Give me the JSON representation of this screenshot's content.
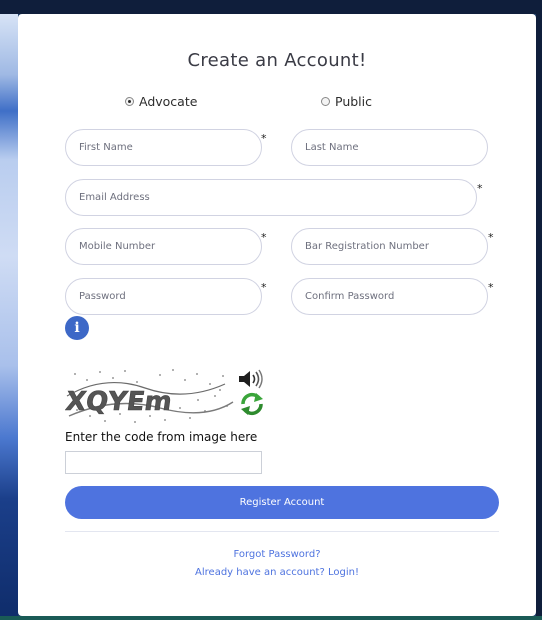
{
  "title": "Create an Account!",
  "user_type": {
    "options": [
      {
        "label": "Advocate",
        "selected": true
      },
      {
        "label": "Public",
        "selected": false
      }
    ]
  },
  "fields": {
    "first_name": {
      "placeholder": "First Name",
      "required": true
    },
    "last_name": {
      "placeholder": "Last Name",
      "required": false
    },
    "email": {
      "placeholder": "Email Address",
      "required": true
    },
    "mobile": {
      "placeholder": "Mobile Number",
      "required": true
    },
    "bar_registration": {
      "placeholder": "Bar Registration Number",
      "required": true
    },
    "password": {
      "placeholder": "Password",
      "required": true
    },
    "confirm_password": {
      "placeholder": "Confirm Password",
      "required": true
    }
  },
  "required_marker": "*",
  "info_glyph": "i",
  "captcha": {
    "text": "XQYEm",
    "instruction": "Enter the code from image here",
    "input_value": ""
  },
  "register_button": "Register Account",
  "links": {
    "forgot_password": "Forgot Password?",
    "login": "Already have an account? Login!"
  },
  "colors": {
    "primary": "#4e73df",
    "info_icon": "#3d68c7",
    "refresh_icon": "#3aa53a",
    "card_bg": "#ffffff"
  },
  "icons": [
    "info-icon",
    "speaker-icon",
    "refresh-icon"
  ]
}
